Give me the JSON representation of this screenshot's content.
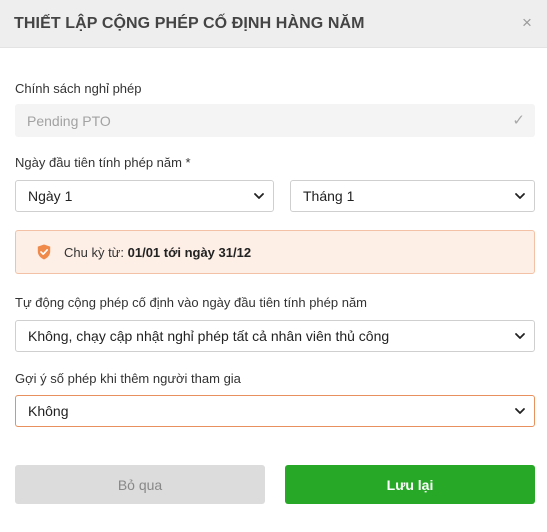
{
  "dialog": {
    "title": "THIẾT LẬP CỘNG PHÉP CỐ ĐỊNH HÀNG NĂM",
    "close": "×"
  },
  "policy": {
    "label": "Chính sách nghỉ phép",
    "value": "Pending PTO",
    "check": "✓"
  },
  "first_day": {
    "label": "Ngày đầu tiên tính phép năm *",
    "day_value": "Ngày 1",
    "month_value": "Tháng 1"
  },
  "cycle_info": {
    "prefix": "Chu kỳ từ: ",
    "range": "01/01 tới ngày 31/12",
    "accent_color": "#f08a4b"
  },
  "auto_accrue": {
    "label": "Tự động cộng phép cố định vào ngày đầu tiên tính phép năm",
    "value": "Không, chạy cập nhật nghỉ phép tất cả nhân viên thủ công"
  },
  "suggest": {
    "label": "Gợi ý số phép khi thêm người tham gia",
    "value": "Không"
  },
  "footer": {
    "skip_label": "Bỏ qua",
    "save_label": "Lưu lại",
    "save_color": "#27a826"
  }
}
